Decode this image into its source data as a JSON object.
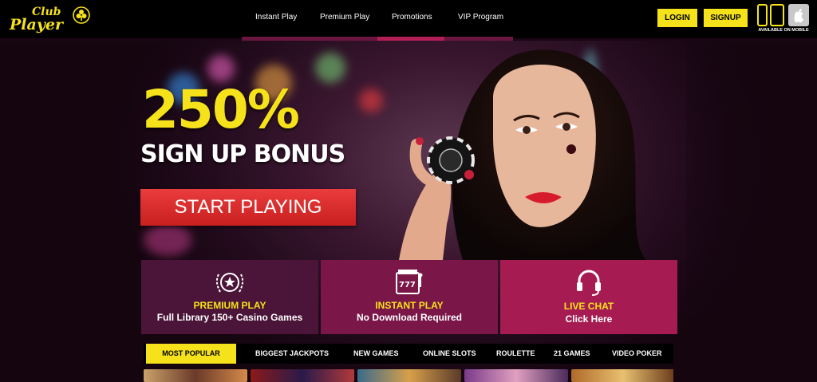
{
  "brand": {
    "logo_text": "Club Player"
  },
  "nav": {
    "items": [
      "Instant Play",
      "Premium Play",
      "Promotions",
      "VIP Program"
    ]
  },
  "header": {
    "login_label": "LOGIN",
    "signup_label": "SIGNUP",
    "mobile_label": "AVAILABLE ON MOBILE"
  },
  "hero": {
    "headline": "250%",
    "subheadline": "SIGN UP BONUS",
    "cta_label": "START PLAYING"
  },
  "features": [
    {
      "title": "PREMIUM PLAY",
      "subtitle": "Full Library 150+ Casino Games",
      "icon": "star-laurel-icon"
    },
    {
      "title": "INSTANT PLAY",
      "subtitle": "No Download Required",
      "icon": "slot-machine-icon"
    },
    {
      "title": "LIVE CHAT",
      "subtitle": "Click Here",
      "icon": "headset-icon"
    }
  ],
  "categories": {
    "items": [
      "MOST POPULAR",
      "BIGGEST JACKPOTS",
      "NEW GAMES",
      "ONLINE SLOTS",
      "ROULETTE",
      "21 GAMES",
      "VIDEO POKER"
    ],
    "active_index": 0
  },
  "colors": {
    "accent_yellow": "#f6e21a",
    "cta_red": "#d92b2b",
    "accent_magenta": "#b41e56"
  }
}
